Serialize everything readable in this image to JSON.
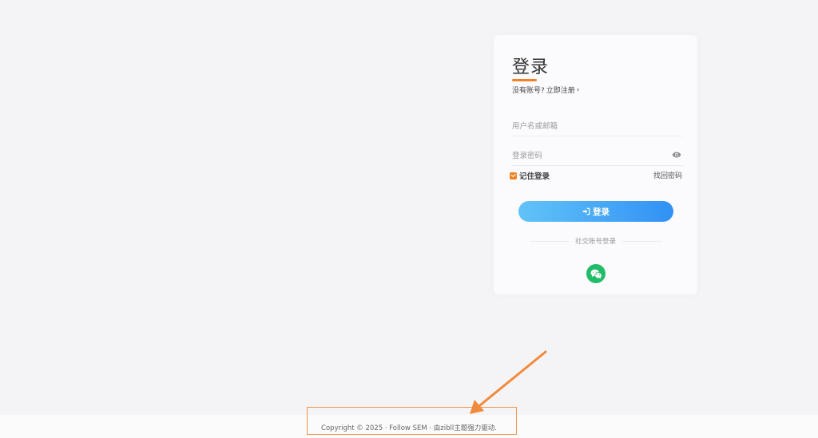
{
  "login": {
    "title": "登录",
    "no_account": "没有账号?",
    "register_link": "立即注册",
    "username_placeholder": "用户名或邮箱",
    "password_placeholder": "登录密码",
    "remember_label": "记住登录",
    "forgot_link": "找回密码",
    "submit_label": "登录",
    "social_divider": "社交账号登录",
    "social_icons": [
      "wechat-icon"
    ]
  },
  "footer": {
    "text": "Copyright © 2025 · Follow SEM · 由zibll主题强力驱动."
  },
  "colors": {
    "accent": "#f48223",
    "button_start": "#62c3f9",
    "button_end": "#3191f4",
    "wechat": "#21bc6a",
    "annotation": "#f08a3c"
  },
  "icons": {
    "eye": "eye-icon",
    "login": "login-icon",
    "checkbox": "checkbox-checked-icon",
    "chevron": "chevron-right-icon"
  }
}
